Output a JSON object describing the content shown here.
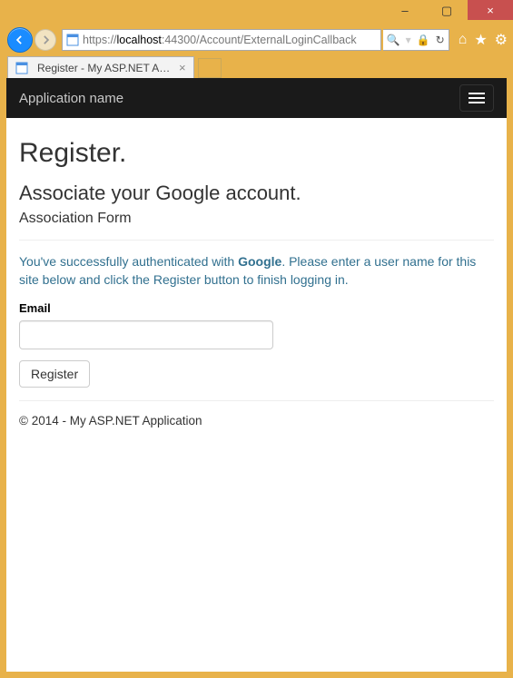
{
  "window": {
    "minimize": "–",
    "restore": "▢",
    "close": "×"
  },
  "browser": {
    "url_prefix": "https://",
    "url_host": "localhost",
    "url_rest": ":44300/Account/ExternalLoginCallback",
    "search_glyph": "🔍",
    "lock_glyph": "🔒",
    "refresh_glyph": "↻",
    "home_glyph": "⌂",
    "star_glyph": "★",
    "gear_glyph": "⚙"
  },
  "tab": {
    "title": "Register - My ASP.NET App...",
    "close": "×"
  },
  "navbar": {
    "brand": "Application name"
  },
  "page": {
    "h1": "Register.",
    "h2": "Associate your Google account.",
    "h3": "Association Form",
    "info_pre": "You've successfully authenticated with ",
    "info_provider": "Google",
    "info_post": ". Please enter a user name for this site below and click the Register button to finish logging in.",
    "email_label": "Email",
    "register_btn": "Register",
    "footer": "© 2014 - My ASP.NET Application"
  }
}
